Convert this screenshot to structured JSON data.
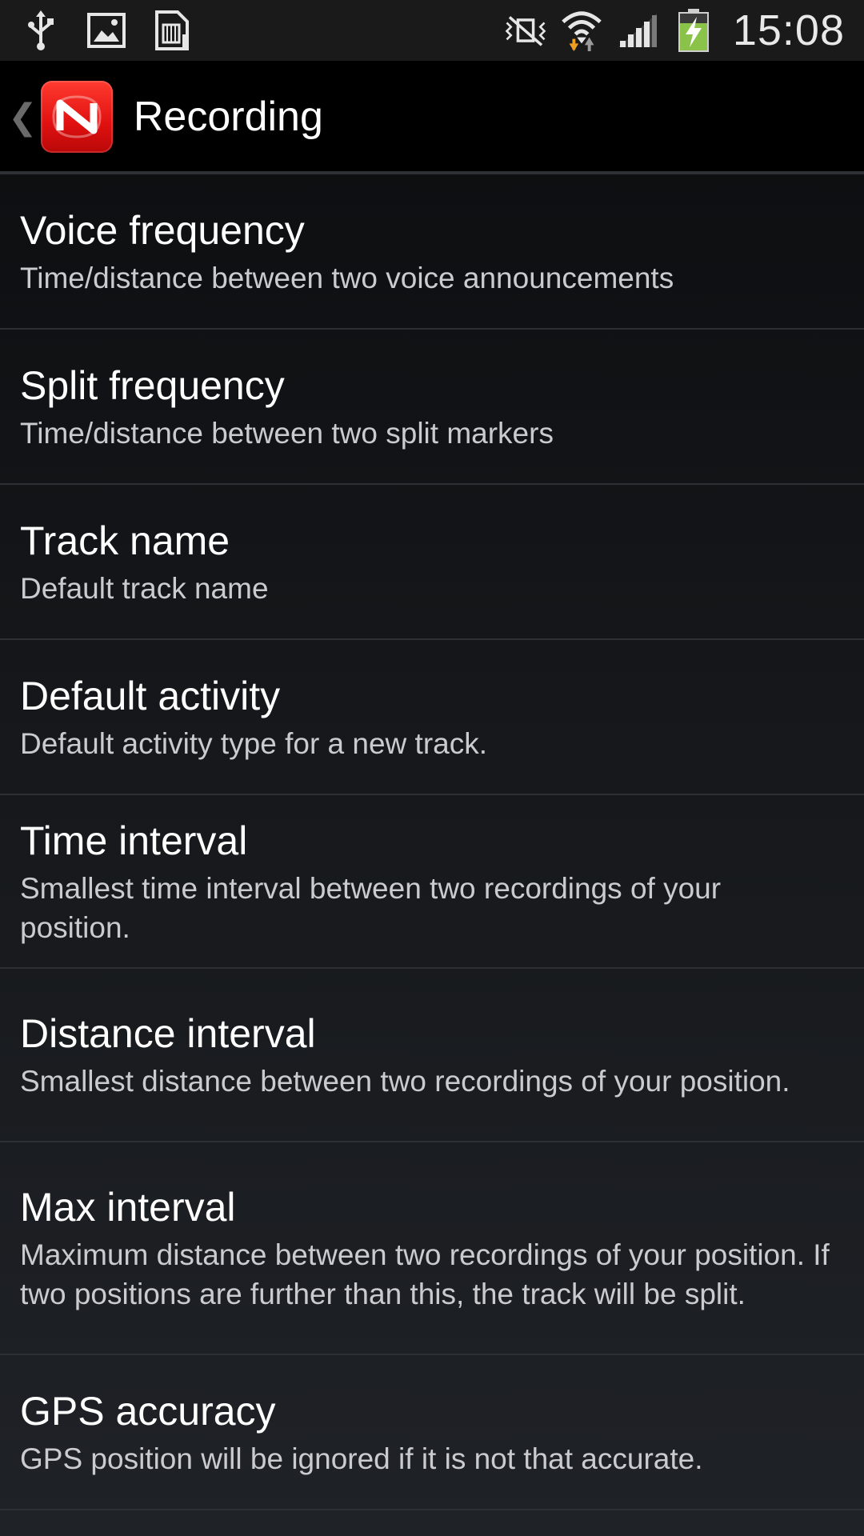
{
  "status_bar": {
    "time": "15:08",
    "icons_left": [
      "usb-icon",
      "gallery-icon",
      "sd-card-icon"
    ],
    "icons_right": [
      "mute-vibrate-icon",
      "wifi-icon",
      "signal-icon",
      "battery-charging-icon"
    ],
    "battery_color": "#8bc34a",
    "wifi_arrow_color": "#f0a020"
  },
  "action_bar": {
    "title": "Recording",
    "back_glyph": "❮",
    "logo_color": "#e01010"
  },
  "preferences": [
    {
      "title": "Voice frequency",
      "summary": "Time/distance between two voice announcements"
    },
    {
      "title": "Split frequency",
      "summary": "Time/distance between two split markers"
    },
    {
      "title": "Track name",
      "summary": "Default track name"
    },
    {
      "title": "Default activity",
      "summary": "Default activity type for a new track."
    },
    {
      "title": "Time interval",
      "summary": "Smallest time interval between two recordings of your position."
    },
    {
      "title": "Distance interval",
      "summary": "Smallest distance between two recordings of your position."
    },
    {
      "title": "Max interval",
      "summary": "Maximum distance between two recordings of your position. If two positions are further than this, the track will be split."
    },
    {
      "title": "GPS accuracy",
      "summary": "GPS position will be ignored if it is not that accurate."
    }
  ]
}
